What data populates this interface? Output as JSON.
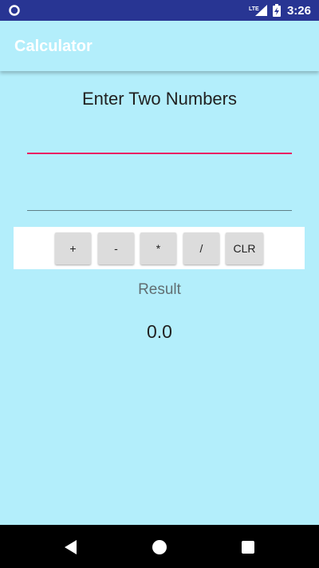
{
  "status_bar": {
    "network_label": "LTE",
    "time": "3:26",
    "background_color": "#283593"
  },
  "app_bar": {
    "title": "Calculator"
  },
  "main": {
    "heading": "Enter Two Numbers",
    "first_number": {
      "value": "",
      "placeholder": ""
    },
    "second_number": {
      "value": "",
      "placeholder": ""
    },
    "operations": {
      "add": "+",
      "subtract": "-",
      "multiply": "*",
      "divide": "/",
      "clear": "CLR"
    },
    "result_label": "Result",
    "result_value": "0.0"
  },
  "colors": {
    "background": "#b3eefb",
    "accent": "#e91e63",
    "button_panel": "#ffffff",
    "button": "#dcdcdc"
  },
  "nav_bar": {
    "icons": [
      "back-icon",
      "home-icon",
      "recent-apps-icon"
    ]
  }
}
